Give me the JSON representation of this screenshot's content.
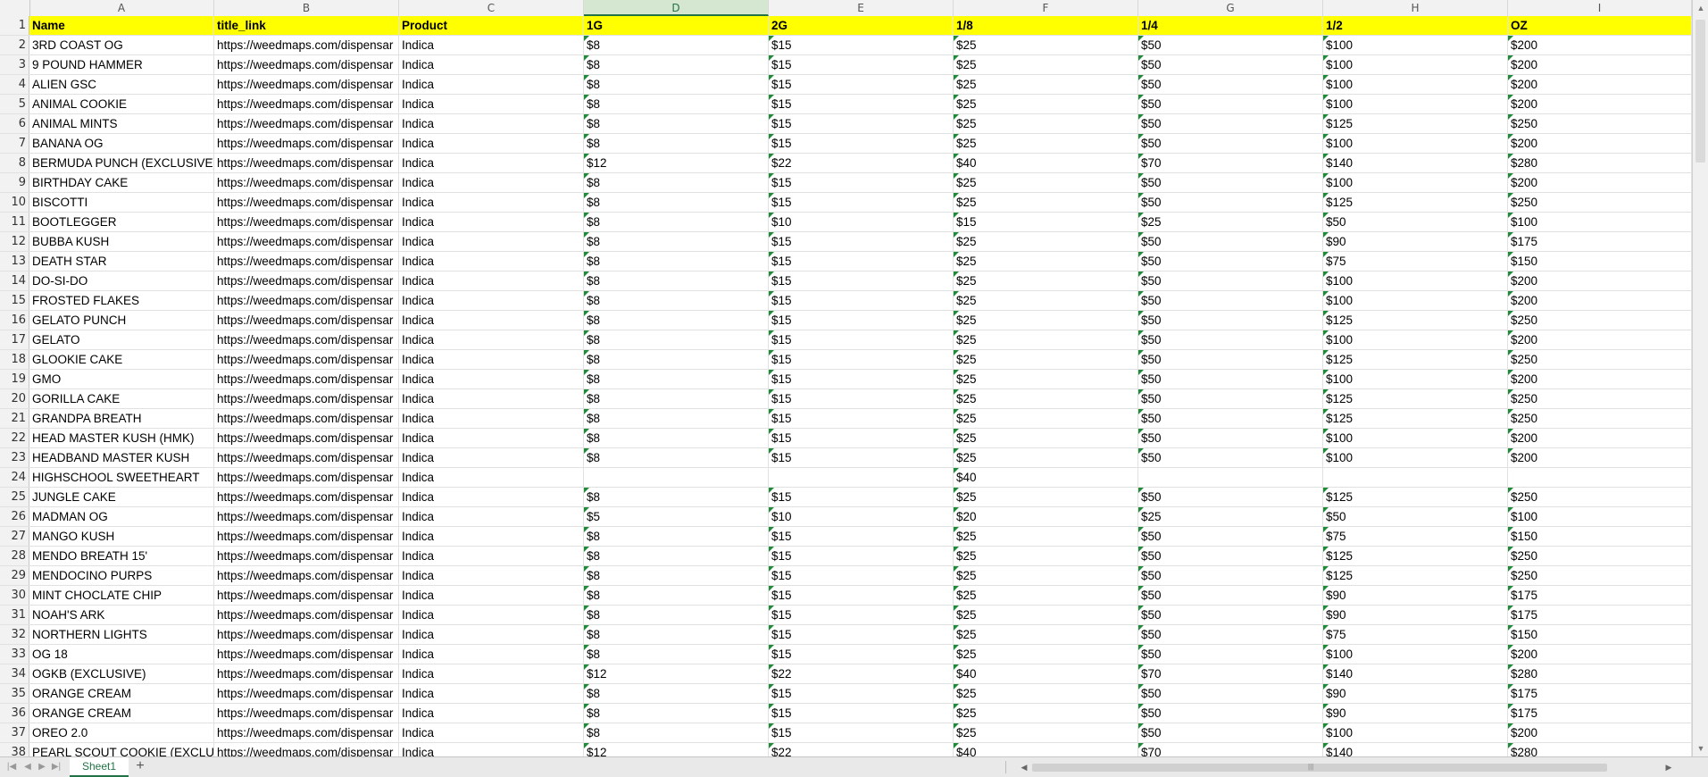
{
  "columns": [
    "A",
    "B",
    "C",
    "D",
    "E",
    "F",
    "G",
    "H",
    "I"
  ],
  "selected_column": "D",
  "header": [
    "Name",
    "title_link",
    "Product",
    "1G",
    "2G",
    "1/8",
    "1/4",
    "1/2",
    "OZ"
  ],
  "rows": [
    [
      "3RD COAST OG",
      "https://weedmaps.com/dispensar",
      "Indica",
      "$8",
      "$15",
      "$25",
      "$50",
      "$100",
      "$200"
    ],
    [
      "9 POUND HAMMER",
      "https://weedmaps.com/dispensar",
      "Indica",
      "$8",
      "$15",
      "$25",
      "$50",
      "$100",
      "$200"
    ],
    [
      "ALIEN GSC",
      "https://weedmaps.com/dispensar",
      "Indica",
      "$8",
      "$15",
      "$25",
      "$50",
      "$100",
      "$200"
    ],
    [
      "ANIMAL COOKIE",
      "https://weedmaps.com/dispensar",
      "Indica",
      "$8",
      "$15",
      "$25",
      "$50",
      "$100",
      "$200"
    ],
    [
      "ANIMAL MINTS",
      "https://weedmaps.com/dispensar",
      "Indica",
      "$8",
      "$15",
      "$25",
      "$50",
      "$125",
      "$250"
    ],
    [
      "BANANA OG",
      "https://weedmaps.com/dispensar",
      "Indica",
      "$8",
      "$15",
      "$25",
      "$50",
      "$100",
      "$200"
    ],
    [
      "BERMUDA PUNCH (EXCLUSIVE)",
      "https://weedmaps.com/dispensar",
      "Indica",
      "$12",
      "$22",
      "$40",
      "$70",
      "$140",
      "$280"
    ],
    [
      "BIRTHDAY CAKE",
      "https://weedmaps.com/dispensar",
      "Indica",
      "$8",
      "$15",
      "$25",
      "$50",
      "$100",
      "$200"
    ],
    [
      "BISCOTTI",
      "https://weedmaps.com/dispensar",
      "Indica",
      "$8",
      "$15",
      "$25",
      "$50",
      "$125",
      "$250"
    ],
    [
      "BOOTLEGGER",
      "https://weedmaps.com/dispensar",
      "Indica",
      "$8",
      "$10",
      "$15",
      "$25",
      "$50",
      "$100"
    ],
    [
      "BUBBA KUSH",
      "https://weedmaps.com/dispensar",
      "Indica",
      "$8",
      "$15",
      "$25",
      "$50",
      "$90",
      "$175"
    ],
    [
      "DEATH STAR",
      "https://weedmaps.com/dispensar",
      "Indica",
      "$8",
      "$15",
      "$25",
      "$50",
      "$75",
      "$150"
    ],
    [
      "DO-SI-DO",
      "https://weedmaps.com/dispensar",
      "Indica",
      "$8",
      "$15",
      "$25",
      "$50",
      "$100",
      "$200"
    ],
    [
      "FROSTED FLAKES",
      "https://weedmaps.com/dispensar",
      "Indica",
      "$8",
      "$15",
      "$25",
      "$50",
      "$100",
      "$200"
    ],
    [
      "GELATO PUNCH",
      "https://weedmaps.com/dispensar",
      "Indica",
      "$8",
      "$15",
      "$25",
      "$50",
      "$125",
      "$250"
    ],
    [
      "GELATO",
      "https://weedmaps.com/dispensar",
      "Indica",
      "$8",
      "$15",
      "$25",
      "$50",
      "$100",
      "$200"
    ],
    [
      "GLOOKIE CAKE",
      "https://weedmaps.com/dispensar",
      "Indica",
      "$8",
      "$15",
      "$25",
      "$50",
      "$125",
      "$250"
    ],
    [
      "GMO",
      "https://weedmaps.com/dispensar",
      "Indica",
      "$8",
      "$15",
      "$25",
      "$50",
      "$100",
      "$200"
    ],
    [
      "GORILLA CAKE",
      "https://weedmaps.com/dispensar",
      "Indica",
      "$8",
      "$15",
      "$25",
      "$50",
      "$125",
      "$250"
    ],
    [
      "GRANDPA BREATH",
      "https://weedmaps.com/dispensar",
      "Indica",
      "$8",
      "$15",
      "$25",
      "$50",
      "$125",
      "$250"
    ],
    [
      "HEAD MASTER KUSH (HMK)",
      "https://weedmaps.com/dispensar",
      "Indica",
      "$8",
      "$15",
      "$25",
      "$50",
      "$100",
      "$200"
    ],
    [
      "HEADBAND MASTER KUSH",
      "https://weedmaps.com/dispensar",
      "Indica",
      "$8",
      "$15",
      "$25",
      "$50",
      "$100",
      "$200"
    ],
    [
      "HIGHSCHOOL SWEETHEART",
      "https://weedmaps.com/dispensar",
      "Indica",
      "",
      "",
      "$40",
      "",
      "",
      ""
    ],
    [
      "JUNGLE CAKE",
      "https://weedmaps.com/dispensar",
      "Indica",
      "$8",
      "$15",
      "$25",
      "$50",
      "$125",
      "$250"
    ],
    [
      "MADMAN OG",
      "https://weedmaps.com/dispensar",
      "Indica",
      "$5",
      "$10",
      "$20",
      "$25",
      "$50",
      "$100"
    ],
    [
      "MANGO KUSH",
      "https://weedmaps.com/dispensar",
      "Indica",
      "$8",
      "$15",
      "$25",
      "$50",
      "$75",
      "$150"
    ],
    [
      "MENDO BREATH 15'",
      "https://weedmaps.com/dispensar",
      "Indica",
      "$8",
      "$15",
      "$25",
      "$50",
      "$125",
      "$250"
    ],
    [
      "MENDOCINO PURPS",
      "https://weedmaps.com/dispensar",
      "Indica",
      "$8",
      "$15",
      "$25",
      "$50",
      "$125",
      "$250"
    ],
    [
      "MINT CHOCLATE CHIP",
      "https://weedmaps.com/dispensar",
      "Indica",
      "$8",
      "$15",
      "$25",
      "$50",
      "$90",
      "$175"
    ],
    [
      "NOAH'S ARK",
      "https://weedmaps.com/dispensar",
      "Indica",
      "$8",
      "$15",
      "$25",
      "$50",
      "$90",
      "$175"
    ],
    [
      "NORTHERN LIGHTS",
      "https://weedmaps.com/dispensar",
      "Indica",
      "$8",
      "$15",
      "$25",
      "$50",
      "$75",
      "$150"
    ],
    [
      "OG 18",
      "https://weedmaps.com/dispensar",
      "Indica",
      "$8",
      "$15",
      "$25",
      "$50",
      "$100",
      "$200"
    ],
    [
      "OGKB (EXCLUSIVE)",
      "https://weedmaps.com/dispensar",
      "Indica",
      "$12",
      "$22",
      "$40",
      "$70",
      "$140",
      "$280"
    ],
    [
      "ORANGE CREAM",
      "https://weedmaps.com/dispensar",
      "Indica",
      "$8",
      "$15",
      "$25",
      "$50",
      "$90",
      "$175"
    ],
    [
      "ORANGE CREAM",
      "https://weedmaps.com/dispensar",
      "Indica",
      "$8",
      "$15",
      "$25",
      "$50",
      "$90",
      "$175"
    ],
    [
      "OREO 2.0",
      "https://weedmaps.com/dispensar",
      "Indica",
      "$8",
      "$15",
      "$25",
      "$50",
      "$100",
      "$200"
    ],
    [
      "PEARL SCOUT COOKIE (EXCLUSI",
      "https://weedmaps.com/dispensar",
      "Indica",
      "$12",
      "$22",
      "$40",
      "$70",
      "$140",
      "$280"
    ]
  ],
  "sheet_tab": "Sheet1",
  "add_sheet_icon": "+"
}
